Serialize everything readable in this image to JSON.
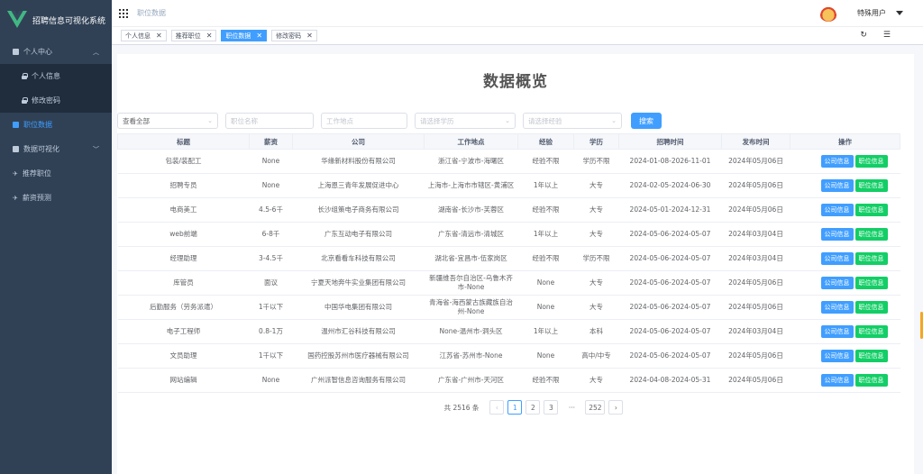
{
  "app": {
    "title": "招聘信息可视化系统"
  },
  "sidebar": {
    "items": [
      {
        "label": "个人中心",
        "icon": "user-square-icon",
        "expanded": true
      },
      {
        "label": "个人信息",
        "icon": "lock-icon",
        "sub": true
      },
      {
        "label": "修改密码",
        "icon": "lock-icon",
        "sub": true
      },
      {
        "label": "职位数据",
        "icon": "table-icon",
        "active": true
      },
      {
        "label": "数据可视化",
        "icon": "chart-square-icon",
        "expanded": false
      },
      {
        "label": "推荐职位",
        "icon": "send-icon"
      },
      {
        "label": "薪资预测",
        "icon": "send-icon"
      }
    ]
  },
  "header": {
    "breadcrumb": "职位数据",
    "user": "特殊用户"
  },
  "tabs": [
    {
      "label": "个人信息",
      "close": "✕"
    },
    {
      "label": "推荐职位",
      "close": "✕"
    },
    {
      "label": "职位数据",
      "close": "✕",
      "active": true
    },
    {
      "label": "修改密码",
      "close": "✕"
    }
  ],
  "page": {
    "title": "数据概览"
  },
  "filters": {
    "view_all": "查看全部",
    "job_name_ph": "职位名称",
    "location_ph": "工作地点",
    "education_ph": "请选择学历",
    "experience_ph": "请选择经验",
    "search": "搜索"
  },
  "table": {
    "headers": [
      "标题",
      "薪资",
      "公司",
      "工作地点",
      "经验",
      "学历",
      "招聘时间",
      "发布时间",
      "操作"
    ],
    "action_company": "公司信息",
    "action_job": "职位信息",
    "rows": [
      [
        "包装/装配工",
        "None",
        "华缘新材料股份有限公司",
        "浙江省-宁波市-海曙区",
        "经验不限",
        "学历不限",
        "2024-01-08-2026-11-01",
        "2024年05月06日"
      ],
      [
        "招聘专员",
        "None",
        "上海恩三青年发展促进中心",
        "上海市-上海市市辖区-黄浦区",
        "1年以上",
        "大专",
        "2024-02-05-2024-06-30",
        "2024年05月06日"
      ],
      [
        "电商美工",
        "4.5-6千",
        "长沙组策电子商务有限公司",
        "湖南省-长沙市-芙蓉区",
        "经验不限",
        "大专",
        "2024-05-01-2024-12-31",
        "2024年05月06日"
      ],
      [
        "web前端",
        "6-8千",
        "广东互动电子有限公司",
        "广东省-清远市-清城区",
        "1年以上",
        "大专",
        "2024-05-06-2024-05-07",
        "2024年03月04日"
      ],
      [
        "经理助理",
        "3-4.5千",
        "北京看看车科技有限公司",
        "湖北省-宜昌市-伍家岗区",
        "经验不限",
        "学历不限",
        "2024-05-06-2024-05-07",
        "2024年03月04日"
      ],
      [
        "库管员",
        "面议",
        "宁夏天地奔牛实业集团有限公司",
        "新疆维吾尔自治区-乌鲁木齐市-None",
        "None",
        "大专",
        "2024-05-06-2024-05-07",
        "2024年05月06日"
      ],
      [
        "后勤服务（劳务派遣）",
        "1千以下",
        "中国华电集团有限公司",
        "青海省-海西蒙古族藏族自治州-None",
        "None",
        "大专",
        "2024-05-06-2024-05-07",
        "2024年05月06日"
      ],
      [
        "电子工程师",
        "0.8-1万",
        "温州市汇谷科技有限公司",
        "None-温州市-洞头区",
        "1年以上",
        "本科",
        "2024-05-06-2024-05-07",
        "2024年03月04日"
      ],
      [
        "文员助理",
        "1千以下",
        "国药控股苏州市医疗器械有限公司",
        "江苏省-苏州市-None",
        "None",
        "高中/中专",
        "2024-05-06-2024-05-07",
        "2024年05月06日"
      ],
      [
        "网站编辑",
        "None",
        "广州派智信息咨询服务有限公司",
        "广东省-广州市-天河区",
        "经验不限",
        "大专",
        "2024-04-08-2024-05-31",
        "2024年05月06日"
      ]
    ]
  },
  "pagination": {
    "total": "共 2516 条",
    "pages": [
      "1",
      "2",
      "3",
      "···",
      "252"
    ],
    "current": "1"
  },
  "colors": {
    "sidebar": "#304156",
    "accent": "#409eff",
    "success": "#13ce66"
  }
}
